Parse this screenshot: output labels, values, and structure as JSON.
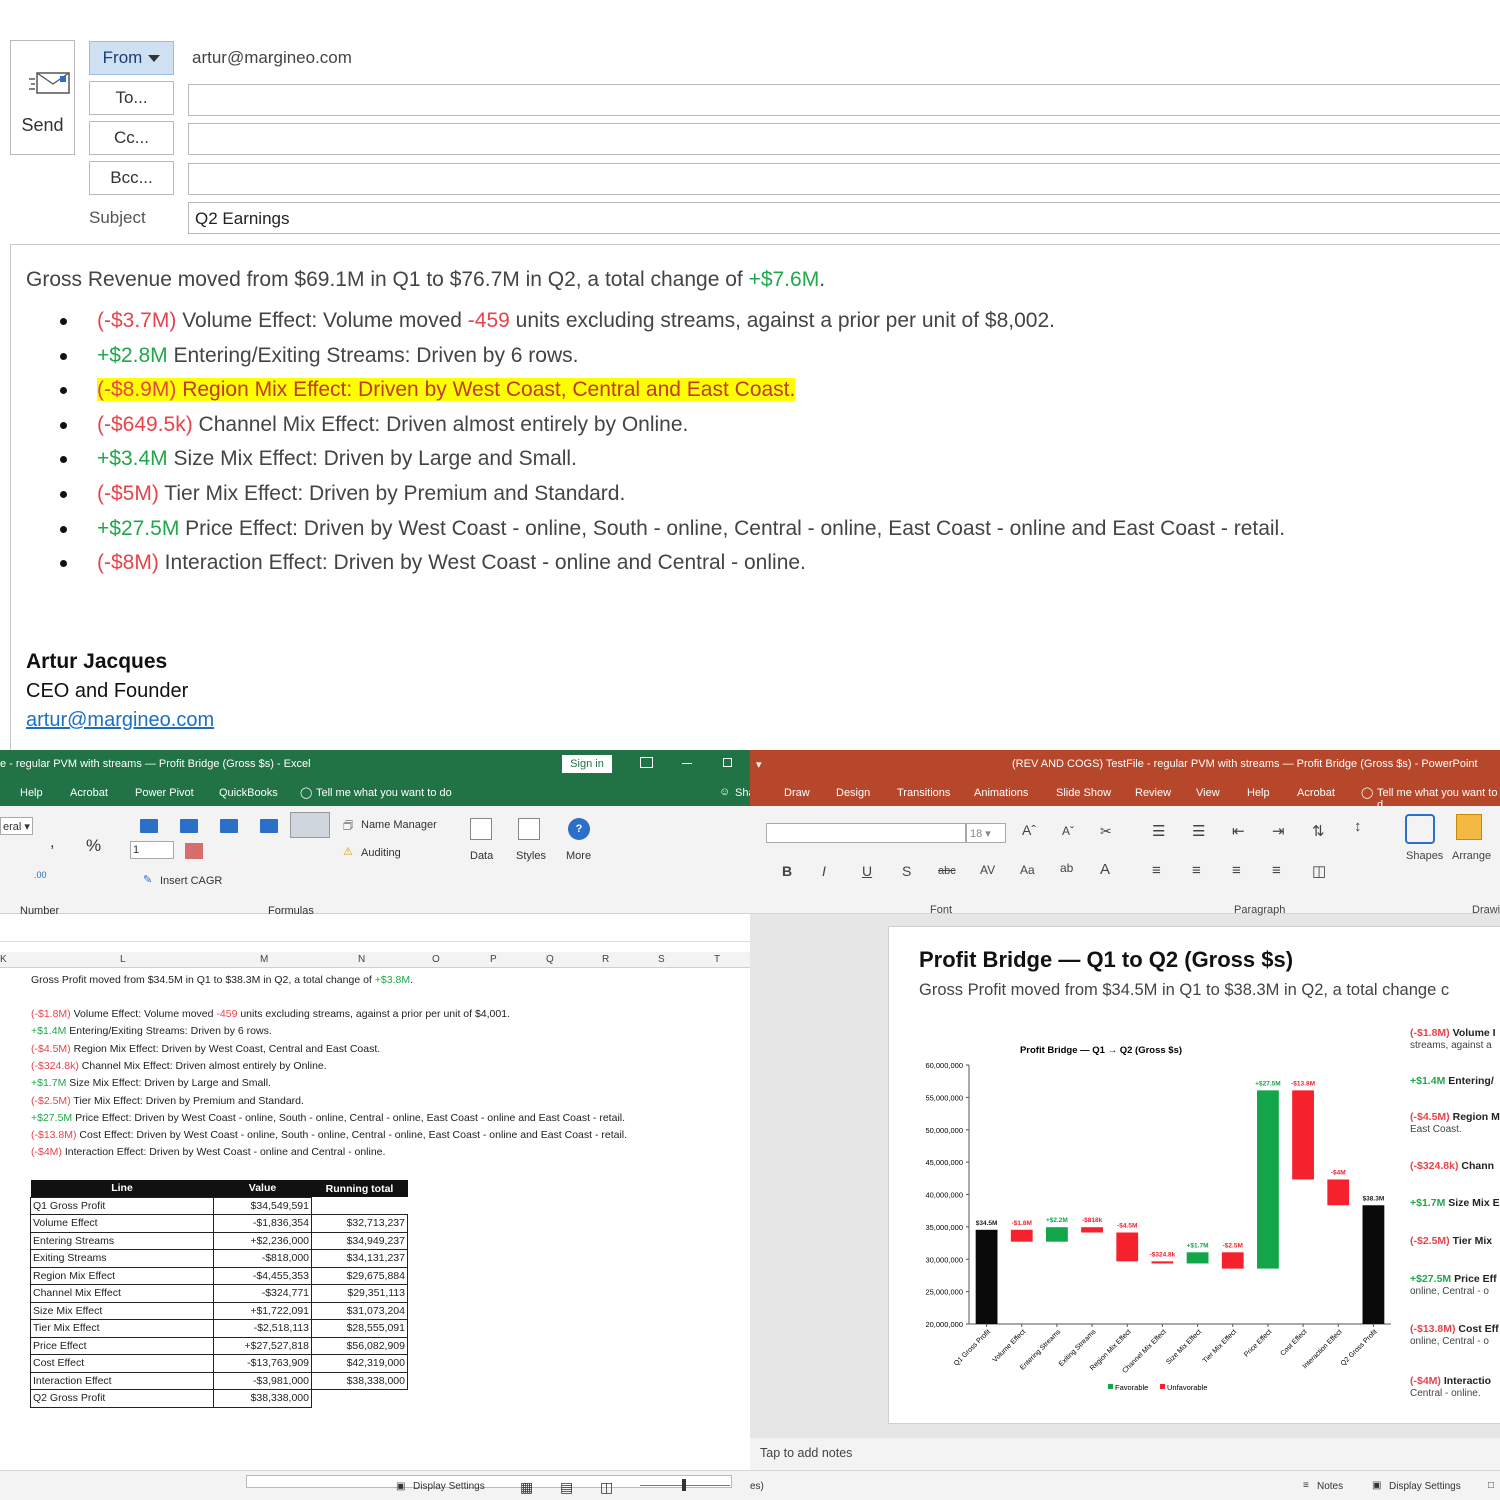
{
  "email": {
    "send_label": "Send",
    "from_label": "From",
    "from_value": "artur@margineo.com",
    "to_label": "To...",
    "cc_label": "Cc...",
    "bcc_label": "Bcc...",
    "subject_label": "Subject",
    "subject_value": "Q2 Earnings",
    "intro_text": "Gross Revenue moved from $69.1M in Q1 to $76.7M in Q2, a total change of ",
    "intro_change": "+$7.6M",
    "intro_end": ".",
    "bullets": [
      {
        "amount": "(-$3.7M)",
        "tone": "neg",
        "pre": " Volume Effect: Volume moved ",
        "inline": "-459",
        "post": " units excluding streams, against a prior per unit of $8,002."
      },
      {
        "amount": "+$2.8M",
        "tone": "pos",
        "pre": " Entering/Exiting Streams: Driven by 6 rows.",
        "inline": "",
        "post": ""
      },
      {
        "amount": "(-$8.9M)",
        "tone": "neg",
        "pre": " Region Mix Effect: Driven by West Coast, Central and East Coast.",
        "inline": "",
        "post": "",
        "highlight": true
      },
      {
        "amount": "(-$649.5k)",
        "tone": "neg",
        "pre": " Channel Mix Effect: Driven almost entirely by Online.",
        "inline": "",
        "post": ""
      },
      {
        "amount": "+$3.4M",
        "tone": "pos",
        "pre": " Size Mix Effect: Driven by Large and Small.",
        "inline": "",
        "post": ""
      },
      {
        "amount": "(-$5M)",
        "tone": "neg",
        "pre": " Tier Mix Effect: Driven by Premium and Standard.",
        "inline": "",
        "post": ""
      },
      {
        "amount": "+$27.5M",
        "tone": "pos",
        "pre": " Price Effect: Driven by West Coast - online, South - online, Central - online, East Coast - online and East Coast - retail.",
        "inline": "",
        "post": ""
      },
      {
        "amount": "(-$8M)",
        "tone": "neg",
        "pre": " Interaction Effect: Driven by West Coast - online and Central - online.",
        "inline": "",
        "post": ""
      }
    ],
    "signature": {
      "name": "Artur Jacques",
      "title": "CEO and Founder",
      "email": "artur@margineo.com"
    }
  },
  "excel": {
    "title": "e - regular PVM with streams — Profit Bridge (Gross $s)  -  Excel",
    "sign_in": "Sign in",
    "share": "Shar",
    "tabs": [
      "Help",
      "Acrobat",
      "Power Pivot",
      "QuickBooks"
    ],
    "tell_me": "Tell me what you want to do",
    "number_format": "eral",
    "decimals": "1",
    "name_manager": "Name Manager",
    "auditing": "Auditing",
    "insert_cagr": "Insert CAGR",
    "data_btn": "Data",
    "styles_btn": "Styles",
    "more_btn": "More",
    "group_number": "Number",
    "group_formulas": "Formulas",
    "columns": [
      "K",
      "L",
      "M",
      "N",
      "O",
      "P",
      "Q",
      "R",
      "S",
      "T"
    ],
    "summary": "Gross Profit moved from $34.5M in Q1 to $38.3M in Q2, a total change of ",
    "summary_change": "+$3.8M",
    "summary_end": ".",
    "lines": [
      {
        "amount": "(-$1.8M)",
        "tone": "neg",
        "pre": " Volume Effect: Volume moved ",
        "inline": "-459",
        "post": " units excluding streams, against a prior per unit of $4,001."
      },
      {
        "amount": "+$1.4M",
        "tone": "pos",
        "pre": " Entering/Exiting Streams: Driven by 6 rows.",
        "inline": "",
        "post": ""
      },
      {
        "amount": "(-$4.5M)",
        "tone": "neg",
        "pre": " Region Mix Effect: Driven by West Coast, Central and East Coast.",
        "inline": "",
        "post": ""
      },
      {
        "amount": "(-$324.8k)",
        "tone": "neg",
        "pre": " Channel Mix Effect: Driven almost entirely by Online.",
        "inline": "",
        "post": ""
      },
      {
        "amount": "+$1.7M",
        "tone": "pos",
        "pre": " Size Mix Effect: Driven by Large and Small.",
        "inline": "",
        "post": ""
      },
      {
        "amount": "(-$2.5M)",
        "tone": "neg",
        "pre": " Tier Mix Effect: Driven by Premium and Standard.",
        "inline": "",
        "post": ""
      },
      {
        "amount": "+$27.5M",
        "tone": "pos",
        "pre": " Price Effect: Driven by West Coast - online, South - online, Central - online, East Coast - online and East Coast - retail.",
        "inline": "",
        "post": ""
      },
      {
        "amount": "(-$13.8M)",
        "tone": "neg",
        "pre": " Cost Effect: Driven by West Coast - online, South - online, Central - online, East Coast - online and East Coast - retail.",
        "inline": "",
        "post": ""
      },
      {
        "amount": "(-$4M)",
        "tone": "neg",
        "pre": " Interaction Effect: Driven by West Coast - online and Central - online.",
        "inline": "",
        "post": ""
      }
    ],
    "table": {
      "headers": [
        "Line",
        "Value",
        "Running total"
      ],
      "rows": [
        [
          "Q1 Gross Profit",
          "$34,549,591",
          ""
        ],
        [
          "Volume Effect",
          "-$1,836,354",
          "$32,713,237"
        ],
        [
          "Entering Streams",
          "+$2,236,000",
          "$34,949,237"
        ],
        [
          "Exiting Streams",
          "-$818,000",
          "$34,131,237"
        ],
        [
          "Region Mix Effect",
          "-$4,455,353",
          "$29,675,884"
        ],
        [
          "Channel Mix Effect",
          "-$324,771",
          "$29,351,113"
        ],
        [
          "Size Mix Effect",
          "+$1,722,091",
          "$31,073,204"
        ],
        [
          "Tier Mix Effect",
          "-$2,518,113",
          "$28,555,091"
        ],
        [
          "Price Effect",
          "+$27,527,818",
          "$56,082,909"
        ],
        [
          "Cost Effect",
          "-$13,763,909",
          "$42,319,000"
        ],
        [
          "Interaction Effect",
          "-$3,981,000",
          "$38,338,000"
        ],
        [
          "Q2 Gross Profit",
          "$38,338,000",
          ""
        ]
      ]
    },
    "status_display": "Display Settings"
  },
  "ppt": {
    "title": "(REV AND COGS) TestFile - regular PVM with streams — Profit Bridge (Gross $s)  -  PowerPoint",
    "tabs": [
      "Draw",
      "Design",
      "Transitions",
      "Animations",
      "Slide Show",
      "Review",
      "View",
      "Help",
      "Acrobat"
    ],
    "tell_me": "Tell me what you want to d",
    "font_size": "18",
    "shapes": "Shapes",
    "arrange": "Arrange",
    "group_font": "Font",
    "group_paragraph": "Paragraph",
    "group_drawing": "Drawi",
    "slide_title": "Profit Bridge — Q1 to Q2 (Gross $s)",
    "slide_subtitle": "Gross Profit moved from $34.5M in Q1 to $38.3M in Q2, a total change c",
    "side": [
      {
        "amount": "(-$1.8M)",
        "tone": "neg",
        "label": " Volume I",
        "sub": "streams, against a"
      },
      {
        "amount": "+$1.4M",
        "tone": "pos",
        "label": " Entering/",
        "sub": ""
      },
      {
        "amount": "(-$4.5M)",
        "tone": "neg",
        "label": " Region M",
        "sub": "East Coast."
      },
      {
        "amount": "(-$324.8k)",
        "tone": "neg",
        "label": " Chann",
        "sub": ""
      },
      {
        "amount": "+$1.7M",
        "tone": "pos",
        "label": " Size Mix E",
        "sub": ""
      },
      {
        "amount": "(-$2.5M)",
        "tone": "neg",
        "label": " Tier Mix",
        "sub": ""
      },
      {
        "amount": "+$27.5M",
        "tone": "pos",
        "label": " Price Eff",
        "sub": "online, Central - o"
      },
      {
        "amount": "(-$13.8M)",
        "tone": "neg",
        "label": " Cost Eff",
        "sub": "online, Central - o"
      },
      {
        "amount": "(-$4M)",
        "tone": "neg",
        "label": " Interactio",
        "sub": "Central - online."
      }
    ],
    "notes": "Tap to add notes",
    "status_left": "es)",
    "status_notes": "Notes",
    "status_display": "Display Settings"
  },
  "colors": {
    "positive": "#1fa84a",
    "negative": "#e8434b",
    "excel_green": "#217346",
    "ppt_orange": "#b7472a",
    "highlight": "#ffff00"
  },
  "chart_data": {
    "type": "bar",
    "title": "Profit Bridge — Q1 → Q2 (Gross $s)",
    "categories": [
      "Q1 Gross Profit",
      "Volume Effect",
      "Entering Streams",
      "Exiting Streams",
      "Region Mix Effect",
      "Channel Mix Effect",
      "Size Mix Effect",
      "Tier Mix Effect",
      "Price Effect",
      "Cost Effect",
      "Interaction Effect",
      "Q2 Gross Profit"
    ],
    "series": [
      {
        "name": "Favorable",
        "color": "#12a54a"
      },
      {
        "name": "Unfavorable",
        "color": "#f5212d"
      }
    ],
    "bars": [
      {
        "kind": "total",
        "start": 0,
        "end": 34549591,
        "label": "$34.5M"
      },
      {
        "kind": "neg",
        "start": 34549591,
        "end": 32713237,
        "label": "-$1.8M"
      },
      {
        "kind": "pos",
        "start": 32713237,
        "end": 34949237,
        "label": "+$2.2M"
      },
      {
        "kind": "neg",
        "start": 34949237,
        "end": 34131237,
        "label": "-$818k"
      },
      {
        "kind": "neg",
        "start": 34131237,
        "end": 29675884,
        "label": "-$4.5M"
      },
      {
        "kind": "neg",
        "start": 29675884,
        "end": 29351113,
        "label": "-$324.8k"
      },
      {
        "kind": "pos",
        "start": 29351113,
        "end": 31073204,
        "label": "+$1.7M"
      },
      {
        "kind": "neg",
        "start": 31073204,
        "end": 28555091,
        "label": "-$2.5M"
      },
      {
        "kind": "pos",
        "start": 28555091,
        "end": 56082909,
        "label": "+$27.5M"
      },
      {
        "kind": "neg",
        "start": 56082909,
        "end": 42319000,
        "label": "-$13.8M"
      },
      {
        "kind": "neg",
        "start": 42319000,
        "end": 38338000,
        "label": "-$4M"
      },
      {
        "kind": "total",
        "start": 0,
        "end": 38338000,
        "label": "$38.3M"
      }
    ],
    "yticks": [
      "60,000,000",
      "55,000,000",
      "50,000,000",
      "45,000,000",
      "40,000,000",
      "35,000,000",
      "30,000,000",
      "25,000,000",
      "20,000,000"
    ],
    "ylim": [
      20000000,
      60000000
    ],
    "legend": "bottom"
  }
}
